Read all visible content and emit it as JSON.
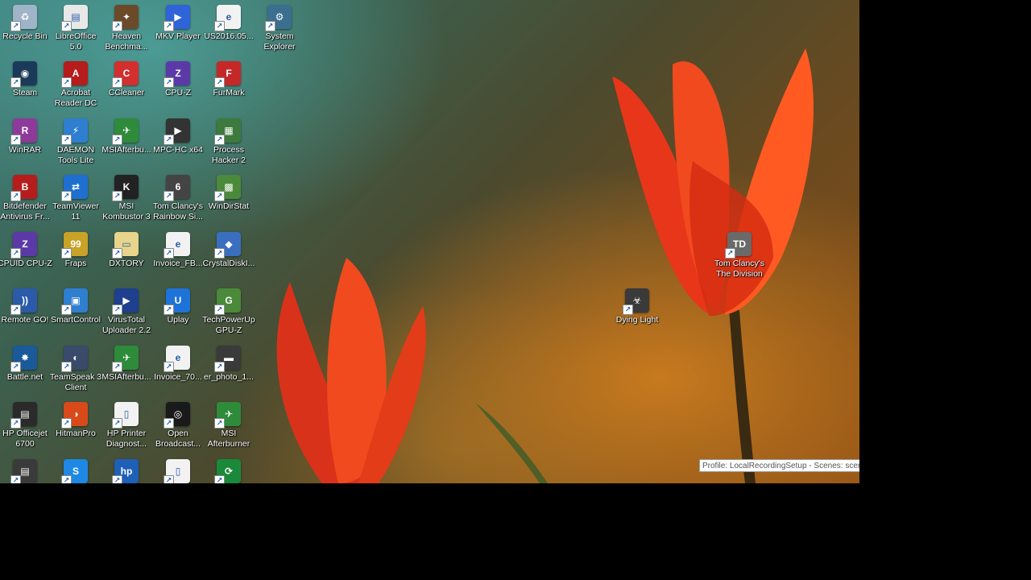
{
  "icons": [
    {
      "label": "Recycle Bin",
      "glyph": "♻",
      "color": "#9fb4c8"
    },
    {
      "label": "LibreOffice\n5.0",
      "glyph": "▤",
      "color": "#e8e8e8"
    },
    {
      "label": "Heaven\nBenchma...",
      "glyph": "✦",
      "color": "#6b4a2a"
    },
    {
      "label": "MKV Player",
      "glyph": "▶",
      "color": "#2f64d8"
    },
    {
      "label": "US2016.05...",
      "glyph": "e",
      "color": "#f2f2f2"
    },
    {
      "label": "System\nExplorer",
      "glyph": "⚙",
      "color": "#3c6e8f"
    },
    {
      "label": "Steam",
      "glyph": "◉",
      "color": "#1b3a5a"
    },
    {
      "label": "Acrobat\nReader DC",
      "glyph": "A",
      "color": "#b71c1c"
    },
    {
      "label": "CCleaner",
      "glyph": "C",
      "color": "#d32f2f"
    },
    {
      "label": "CPU-Z",
      "glyph": "Z",
      "color": "#5b3aa8"
    },
    {
      "label": "FurMark",
      "glyph": "F",
      "color": "#c62828"
    },
    {
      "label": "WinRAR",
      "glyph": "R",
      "color": "#8e3a9a"
    },
    {
      "label": "DAEMON\nTools Lite",
      "glyph": "⚡",
      "color": "#2e7fd0"
    },
    {
      "label": "MSIAfterbu...",
      "glyph": "✈",
      "color": "#2e8b3a"
    },
    {
      "label": "MPC-HC x64",
      "glyph": "▶",
      "color": "#333333"
    },
    {
      "label": "Process\nHacker 2",
      "glyph": "▦",
      "color": "#3d7a3d"
    },
    {
      "label": "Bitdefender\nAntivirus Fr...",
      "glyph": "B",
      "color": "#b71c1c"
    },
    {
      "label": "TeamViewer\n11",
      "glyph": "⇄",
      "color": "#1e6fd0"
    },
    {
      "label": "MSI\nKombustor 3",
      "glyph": "K",
      "color": "#222222"
    },
    {
      "label": "Tom Clancy's\nRainbow Si...",
      "glyph": "6",
      "color": "#444444"
    },
    {
      "label": "WinDirStat",
      "glyph": "▩",
      "color": "#4a8a3a"
    },
    {
      "label": "CPUID CPU-Z",
      "glyph": "Z",
      "color": "#5b3aa8"
    },
    {
      "label": "Fraps",
      "glyph": "99",
      "color": "#c9a227"
    },
    {
      "label": "DXTORY",
      "glyph": "▭",
      "color": "#e8d48a"
    },
    {
      "label": "Invoice_FB...",
      "glyph": "e",
      "color": "#f2f2f2"
    },
    {
      "label": "CrystalDiskI...",
      "glyph": "◆",
      "color": "#3a6fc0"
    },
    {
      "label": "Remote GO!",
      "glyph": "))",
      "color": "#2a5aa8"
    },
    {
      "label": "SmartControl",
      "glyph": "▣",
      "color": "#2f7fd0"
    },
    {
      "label": "VirusTotal\nUploader 2.2",
      "glyph": "▶",
      "color": "#1f3f8f"
    },
    {
      "label": "Uplay",
      "glyph": "U",
      "color": "#1e73d8"
    },
    {
      "label": "TechPowerUp\nGPU-Z",
      "glyph": "G",
      "color": "#4a8a3a"
    },
    {
      "label": "Battle.net",
      "glyph": "✸",
      "color": "#1a5a9a"
    },
    {
      "label": "TeamSpeak 3\nClient",
      "glyph": "◐",
      "color": "#3a4a6a"
    },
    {
      "label": "MSIAfterbu...",
      "glyph": "✈",
      "color": "#2e8b3a"
    },
    {
      "label": "Invoice_70...",
      "glyph": "e",
      "color": "#f2f2f2"
    },
    {
      "label": "er_photo_1...",
      "glyph": "▬",
      "color": "#3a3a3a"
    },
    {
      "label": "HP Officejet\n6700",
      "glyph": "▤",
      "color": "#2a2a2a"
    },
    {
      "label": "HitmanPro",
      "glyph": "◑",
      "color": "#d84a1a"
    },
    {
      "label": "HP Printer\nDiagnost...",
      "glyph": "▯",
      "color": "#f2f2f2"
    },
    {
      "label": "Open\nBroadcast...",
      "glyph": "◎",
      "color": "#1a1a1a"
    },
    {
      "label": "MSI\nAfterburner",
      "glyph": "✈",
      "color": "#2e8b3a"
    },
    {
      "label": "",
      "glyph": "▤",
      "color": "#3a3a3a"
    },
    {
      "label": "",
      "glyph": "S",
      "color": "#1e88e5"
    },
    {
      "label": "",
      "glyph": "hp",
      "color": "#1e5fb8"
    },
    {
      "label": "",
      "glyph": "▯",
      "color": "#f2f2f2"
    },
    {
      "label": "",
      "glyph": "⟳",
      "color": "#1a8a3a"
    },
    {
      "label": "Tom Clancy's\nThe Division",
      "glyph": "TD",
      "color": "#6a6a6a"
    },
    {
      "label": "Dying Light",
      "glyph": "☣",
      "color": "#3a3a3a"
    }
  ],
  "obs_status": "Profile: LocalRecordingSetup - Scenes: scen"
}
